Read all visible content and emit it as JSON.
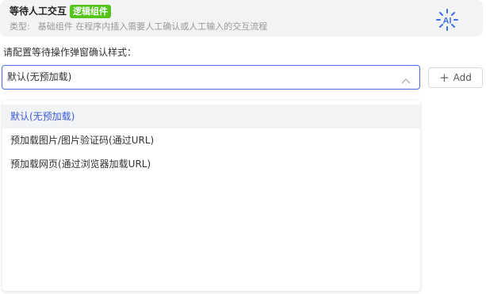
{
  "header": {
    "title": "等待人工交互",
    "tag": "逻辑组件",
    "type_label": "类型:",
    "type_value": "基础组件 在程序内插入需要人工确认或人工输入的交互流程",
    "icon": "ai-sparkle-icon"
  },
  "prompt": "请配置等待操作弹窗确认样式：",
  "select": {
    "value": "默认(无预加载)",
    "arrow_icon": "chevron-up-icon"
  },
  "add_button": {
    "icon": "plus-icon",
    "label": "Add"
  },
  "dropdown": {
    "options": [
      "默认(无预加载)",
      "预加载图片/图片验证码(通过URL)",
      "预加载网页(通过浏览器加载URL)"
    ],
    "selected_index": 0
  },
  "colors": {
    "accent": "#3b5bdb",
    "tag_green": "#52c41a",
    "header_bg": "#f2f3f5"
  }
}
